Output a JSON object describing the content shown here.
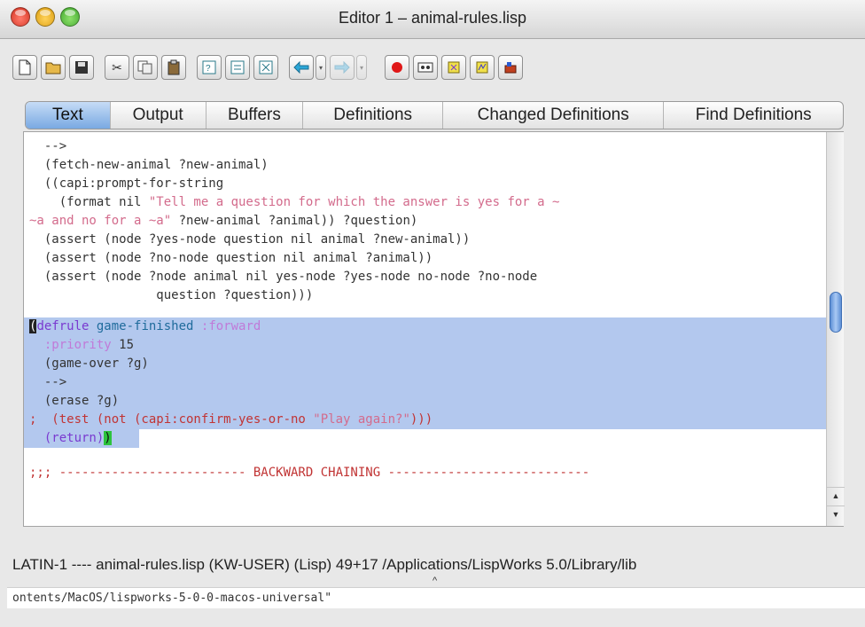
{
  "window": {
    "title": "Editor 1 – animal-rules.lisp"
  },
  "toolbar": {
    "buttons": [
      "new-file-icon",
      "open-folder-icon",
      "save-icon",
      "cut-icon",
      "copy-icon",
      "paste-icon",
      "find-icon",
      "replace-icon",
      "definitions-icon",
      "back-arrow-icon",
      "forward-arrow-icon",
      "record-icon",
      "macro-icon",
      "evaluate-icon",
      "compile-icon",
      "run-icon"
    ]
  },
  "tabs": [
    {
      "label": "Text",
      "active": true
    },
    {
      "label": "Output"
    },
    {
      "label": "Buffers"
    },
    {
      "label": "Definitions"
    },
    {
      "label": "Changed Definitions"
    },
    {
      "label": "Find Definitions"
    }
  ],
  "code": {
    "l1": "  -->",
    "l2": "  (fetch-new-animal ?new-animal)",
    "l3": "  ((capi:prompt-for-string",
    "l4a": "    (format nil ",
    "l4b": "\"Tell me a question for which the answer is yes for a ~",
    "l5a": "~a and no for a ~a\"",
    "l5b": " ?new-animal ?animal)) ?question)",
    "l6": "  (assert (node ?yes-node question nil animal ?new-animal))",
    "l7": "  (assert (node ?no-node question nil animal ?animal))",
    "l8": "  (assert (node ?node animal nil yes-node ?yes-node no-node ?no-node",
    "l9": "                 question ?question)))",
    "s1_cursor": "(",
    "s1_kw": "defrule",
    "s1_name": " game-finished",
    "s1_opt": " :forward",
    "s2_key": "  :priority",
    "s2_val": " 15",
    "s3": "  (game-over ?g)",
    "s4": "  -->",
    "s5": "  (erase ?g)",
    "s6a": ";  (test (not (capi:confirm-yes-or-no ",
    "s6b": "\"Play again?\"",
    "s6c": ")))",
    "s7a": "  (return)",
    "s7b": ")",
    "c1": ";;; ------------------------- BACKWARD CHAINING ---------------------------"
  },
  "status": {
    "line": "LATIN-1 ---- animal-rules.lisp    (KW-USER) (Lisp) 49+17 /Applications/LispWorks 5.0/Library/lib"
  },
  "minibuffer": {
    "text": "ontents/MacOS/lispworks-5-0-0-macos-universal\""
  },
  "colors": {
    "selection": "#b3c8ee",
    "active_tab": "#79a9e2",
    "comment": "#c13434",
    "string": "#d36b8c",
    "keyword": "#7a3ad0"
  }
}
